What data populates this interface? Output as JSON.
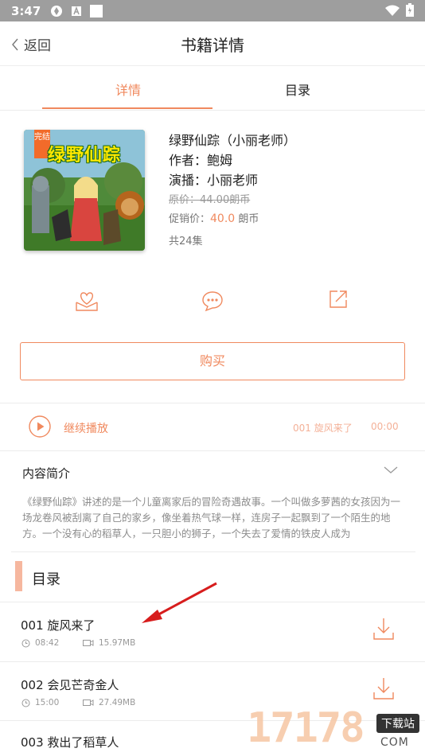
{
  "status_bar": {
    "time": "3:47"
  },
  "nav": {
    "back_label": "返回",
    "title": "书籍详情"
  },
  "tabs": [
    {
      "label": "详情"
    },
    {
      "label": "目录"
    }
  ],
  "book": {
    "cover_badge": "完结",
    "cover_title": "绿野仙踪",
    "title": "绿野仙踪（小丽老师）",
    "author": "作者：鲍姆",
    "narrator": "演播：小丽老师",
    "original_price": "原价：44.00朗币",
    "promo_label": "促销价：",
    "promo_value": "40.0",
    "promo_unit": " 朗币",
    "episodes": "共24集"
  },
  "actions": [
    {
      "name": "favorite-icon"
    },
    {
      "name": "comment-icon"
    },
    {
      "name": "share-icon"
    }
  ],
  "buy_label": "购买",
  "continue": {
    "label": "继续播放",
    "episode": "001 旋风来了",
    "time": "00:00"
  },
  "intro": {
    "title": "内容简介",
    "text": "《绿野仙踪》讲述的是一个儿童离家后的冒险奇遇故事。一个叫做多萝茜的女孩因为一场龙卷风被刮离了自己的家乡，像坐着热气球一样，连房子一起飘到了一个陌生的地方。一个没有心的稻草人，一只胆小的狮子，一个失去了爱情的铁皮人成为"
  },
  "toc": {
    "title": "目录",
    "items": [
      {
        "name": "001 旋风来了",
        "duration": "08:42",
        "size": "15.97MB"
      },
      {
        "name": "002 会见芒奇金人",
        "duration": "15:00",
        "size": "27.49MB"
      },
      {
        "name": "003 救出了稻草人",
        "duration": "",
        "size": ""
      }
    ]
  },
  "watermark": {
    "number": "17178",
    "badge": "下载站",
    "suffix": "COM"
  },
  "colors": {
    "accent": "#f0895e",
    "accent_light": "#f6b79f",
    "status_bar": "#9e9e9e"
  }
}
